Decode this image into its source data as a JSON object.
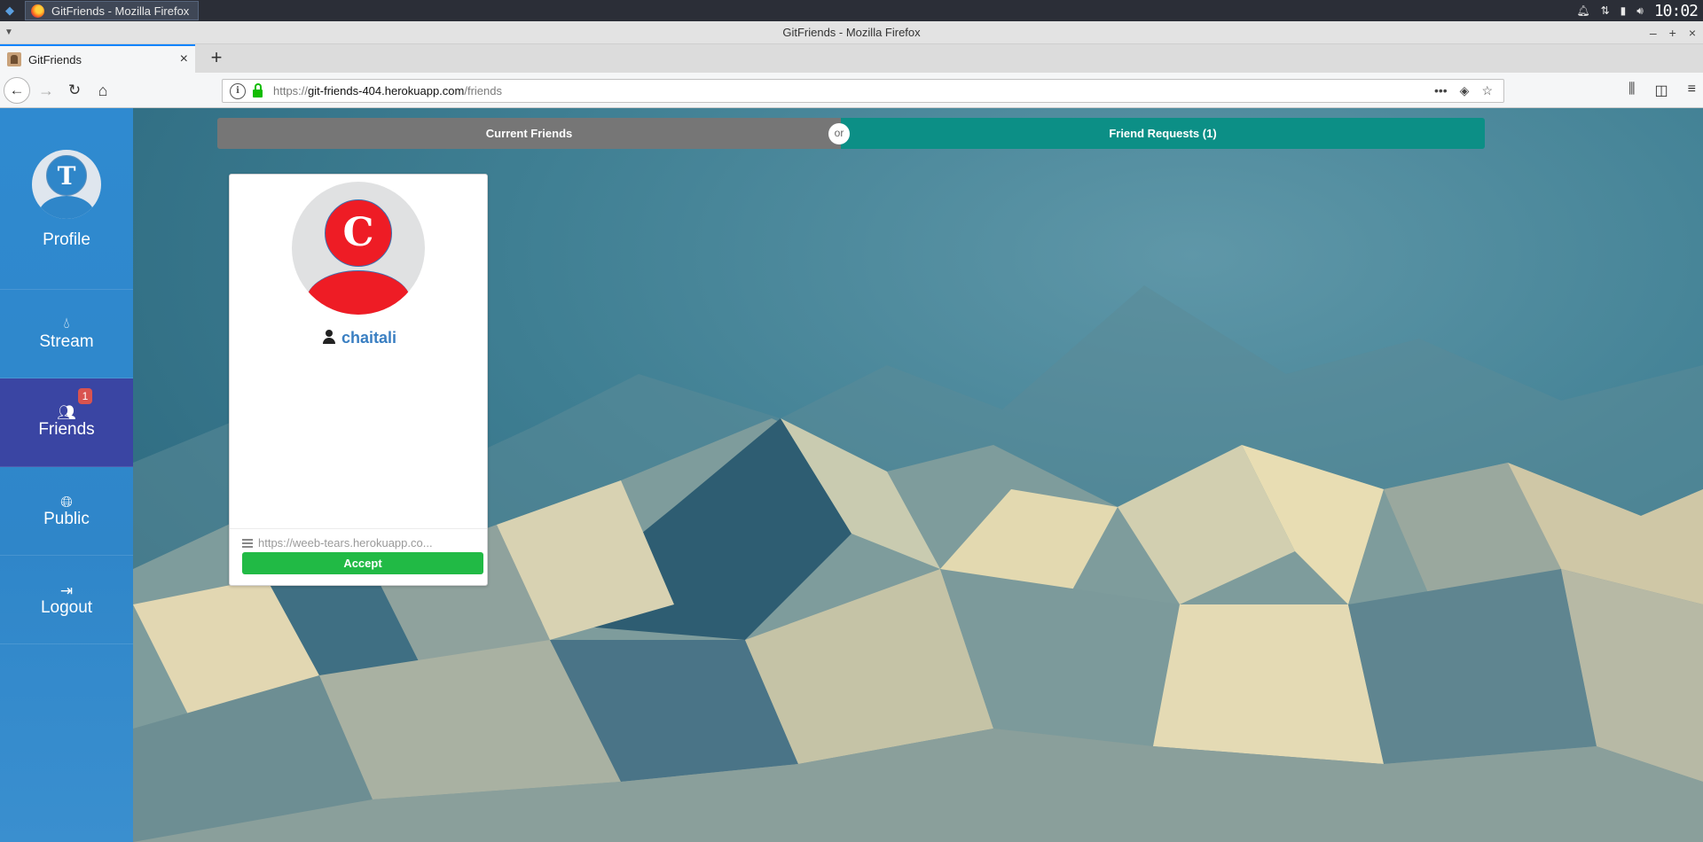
{
  "os": {
    "task_title": "GitFriends - Mozilla Firefox",
    "clock": "10:02"
  },
  "browser": {
    "window_title": "GitFriends - Mozilla Firefox",
    "tab_title": "GitFriends",
    "url_scheme": "https://",
    "url_host": "git-friends-404.herokuapp.com",
    "url_path": "/friends"
  },
  "sidebar": {
    "profile": {
      "label": "Profile",
      "avatar_letter": "T"
    },
    "items": [
      {
        "label": "Stream",
        "icon": "droplet-icon"
      },
      {
        "label": "Friends",
        "icon": "users-icon",
        "badge": "1"
      },
      {
        "label": "Public",
        "icon": "globe-icon"
      },
      {
        "label": "Logout",
        "icon": "sign-out-icon"
      }
    ]
  },
  "toggle": {
    "current_label": "Current Friends",
    "or_label": "or",
    "requests_label": "Friend Requests (1)"
  },
  "requests": [
    {
      "avatar_letter": "C",
      "username": "chaitali",
      "host": "https://weeb-tears.herokuapp.co...",
      "accept_label": "Accept"
    }
  ],
  "colors": {
    "sidebar": "#2f86c9",
    "sidebar_active": "#3a45a3",
    "toggle_inactive": "#767676",
    "toggle_active": "#0c8f86",
    "accept": "#21ba45",
    "avatar_red": "#ee1c25",
    "badge": "#d9534f"
  }
}
